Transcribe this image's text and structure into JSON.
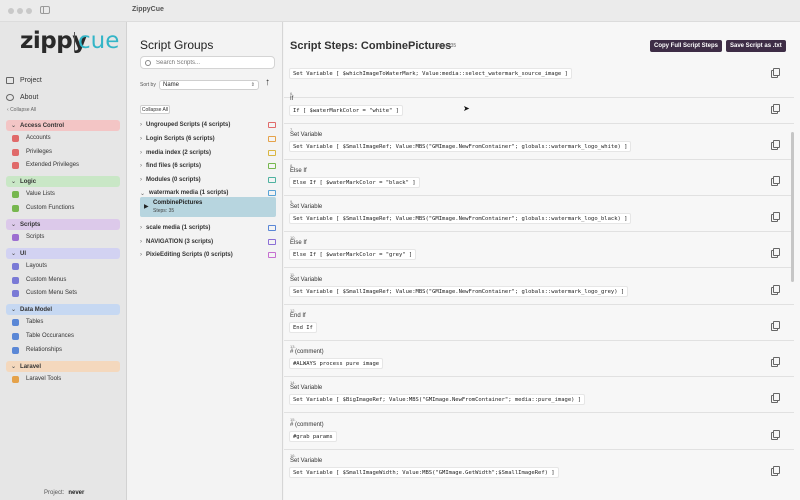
{
  "app": {
    "title": "ZippyCue"
  },
  "logo": {
    "part1": "zippy",
    "part2": "cue"
  },
  "sidebar": {
    "top_items": [
      {
        "label": "Project",
        "icon": "folder-icon"
      },
      {
        "label": "About",
        "icon": "info-icon"
      }
    ],
    "collapse_all": "Collapse All",
    "groups": [
      {
        "label": "Access Control",
        "color": "#f3c5c5",
        "items": [
          "Accounts",
          "Privileges",
          "Extended Privileges"
        ]
      },
      {
        "label": "Logic",
        "color": "#c9e7c6",
        "items": [
          "Value Lists",
          "Custom Functions"
        ]
      },
      {
        "label": "Scripts",
        "color": "#dcc9ea",
        "items": [
          "Scripts"
        ]
      },
      {
        "label": "UI",
        "color": "#d2d2f2",
        "items": [
          "Layouts",
          "Custom Menus",
          "Custom Menu Sets"
        ]
      },
      {
        "label": "Data Model",
        "color": "#c6d8f2",
        "items": [
          "Tables",
          "Table Occurances",
          "Relationships"
        ]
      },
      {
        "label": "Laravel",
        "color": "#f4d8bd",
        "items": [
          "Laravel Tools"
        ]
      }
    ],
    "footer": {
      "label": "Project:",
      "value": "never"
    }
  },
  "groups_panel": {
    "title": "Script Groups",
    "search_placeholder": "Search Scripts...",
    "sort_label": "Sort by",
    "sort_value": "Name",
    "sort_direction_icon": "↑",
    "collapse_all": "Collapse All",
    "groups": [
      {
        "label": "Ungrouped Scripts (4 scripts)",
        "folder_color": "#e06a6a"
      },
      {
        "label": "Login Scripts (6 scripts)",
        "folder_color": "#e5a24a"
      },
      {
        "label": "media index (2 scripts)",
        "folder_color": "#d9b642"
      },
      {
        "label": "find files (6 scripts)",
        "folder_color": "#77b74f"
      },
      {
        "label": "Modules (0 scripts)",
        "folder_color": "#4fb2a0"
      },
      {
        "label": "watermark media (1 scripts)",
        "folder_color": "#5aa3d6",
        "expanded": true
      },
      {
        "label": "scale media (1 scripts)",
        "folder_color": "#5a87d6"
      },
      {
        "label": "NAVIGATION (3 scripts)",
        "folder_color": "#8c6fd6"
      },
      {
        "label": "PixieEditing Scripts (0 scripts)",
        "folder_color": "#c56fd0"
      }
    ],
    "selected_script": {
      "name": "CombinePictures",
      "steps": "Steps: 35"
    }
  },
  "steps_panel": {
    "title_prefix": "Script Steps:",
    "script_name": "CombinePictures",
    "count": "Steps: 35",
    "copy_button": "Copy Full Script Steps",
    "save_button": "Save Script as .txt",
    "steps": [
      {
        "num": "",
        "label": "",
        "code": "Set Variable [ $whichImageToWaterMark; Value:media::select_watermark_source_image ]"
      },
      {
        "num": "6.",
        "label": "If",
        "code": "If [ $waterMarkColor = \"white\" ]"
      },
      {
        "num": "7.",
        "label": "Set Variable",
        "code": "Set Variable [ $SmallImageRef; Value:MBS(\"GMImage.NewFromContainer\"; globals::watermark_logo_white) ]"
      },
      {
        "num": "8.",
        "label": "Else If",
        "code": "Else If [ $waterMarkColor = \"black\" ]"
      },
      {
        "num": "9.",
        "label": "Set Variable",
        "code": "Set Variable [ $SmallImageRef; Value:MBS(\"GMImage.NewFromContainer\"; globals::watermark_logo_black) ]"
      },
      {
        "num": "10.",
        "label": "Else If",
        "code": "Else If [ $waterMarkColor = \"grey\" ]"
      },
      {
        "num": "11.",
        "label": "Set Variable",
        "code": "Set Variable [ $SmallImageRef; Value:MBS(\"GMImage.NewFromContainer\"; globals::watermark_logo_grey) ]"
      },
      {
        "num": "12.",
        "label": "End If",
        "code": "End If"
      },
      {
        "num": "13.",
        "label": "# (comment)",
        "code": "#ALWAYS process pure image"
      },
      {
        "num": "14.",
        "label": "Set Variable",
        "code": "Set Variable [ $BigImageRef; Value:MBS(\"GMImage.NewFromContainer\"; media::pure_image) ]"
      },
      {
        "num": "15.",
        "label": "# (comment)",
        "code": "#grab params"
      },
      {
        "num": "16.",
        "label": "Set Variable",
        "code": "Set Variable [ $SmallImageWidth; Value:MBS(\"GMImage.GetWidth\";$SmallImageRef) ]"
      }
    ]
  }
}
